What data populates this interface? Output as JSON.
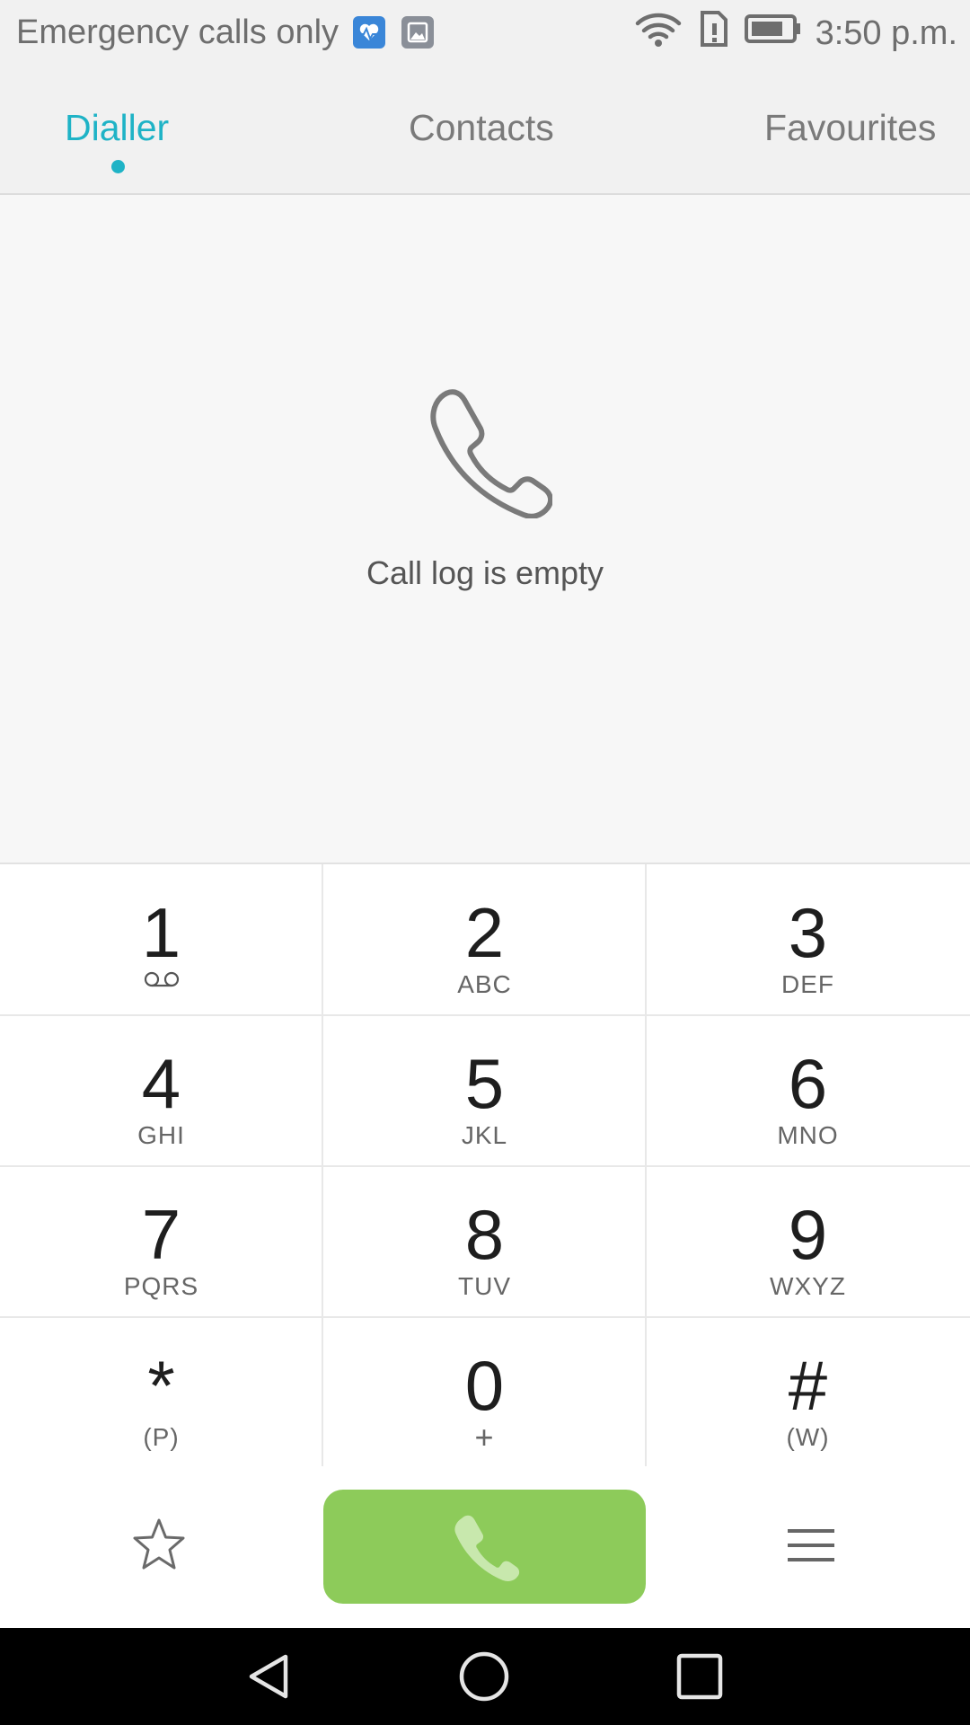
{
  "status_bar": {
    "carrier_text": "Emergency calls only",
    "time": "3:50 p.m.",
    "icons": [
      "health-notification-icon",
      "gallery-notification-icon",
      "wifi-icon",
      "sim-alert-icon",
      "battery-icon"
    ]
  },
  "tabs": [
    {
      "label": "Dialler",
      "active": true
    },
    {
      "label": "Contacts",
      "active": false
    },
    {
      "label": "Favourites",
      "active": false
    }
  ],
  "accent_color": "#1fb3c6",
  "call_button_color": "#8dcb5a",
  "empty_state": {
    "icon": "phone-outline-icon",
    "message": "Call log is empty"
  },
  "keypad": {
    "keys": [
      {
        "digit": "1",
        "letters": ""
      },
      {
        "digit": "2",
        "letters": "ABC"
      },
      {
        "digit": "3",
        "letters": "DEF"
      },
      {
        "digit": "4",
        "letters": "GHI"
      },
      {
        "digit": "5",
        "letters": "JKL"
      },
      {
        "digit": "6",
        "letters": "MNO"
      },
      {
        "digit": "7",
        "letters": "PQRS"
      },
      {
        "digit": "8",
        "letters": "TUV"
      },
      {
        "digit": "9",
        "letters": "WXYZ"
      },
      {
        "digit": "*",
        "letters": "(P)"
      },
      {
        "digit": "0",
        "letters": "+"
      },
      {
        "digit": "#",
        "letters": "(W)"
      }
    ]
  },
  "action_bar": {
    "left_icon": "star-icon",
    "center_icon": "phone-icon",
    "right_icon": "menu-icon"
  },
  "nav_bar": {
    "icons": [
      "back-icon",
      "home-icon",
      "recents-icon"
    ]
  }
}
